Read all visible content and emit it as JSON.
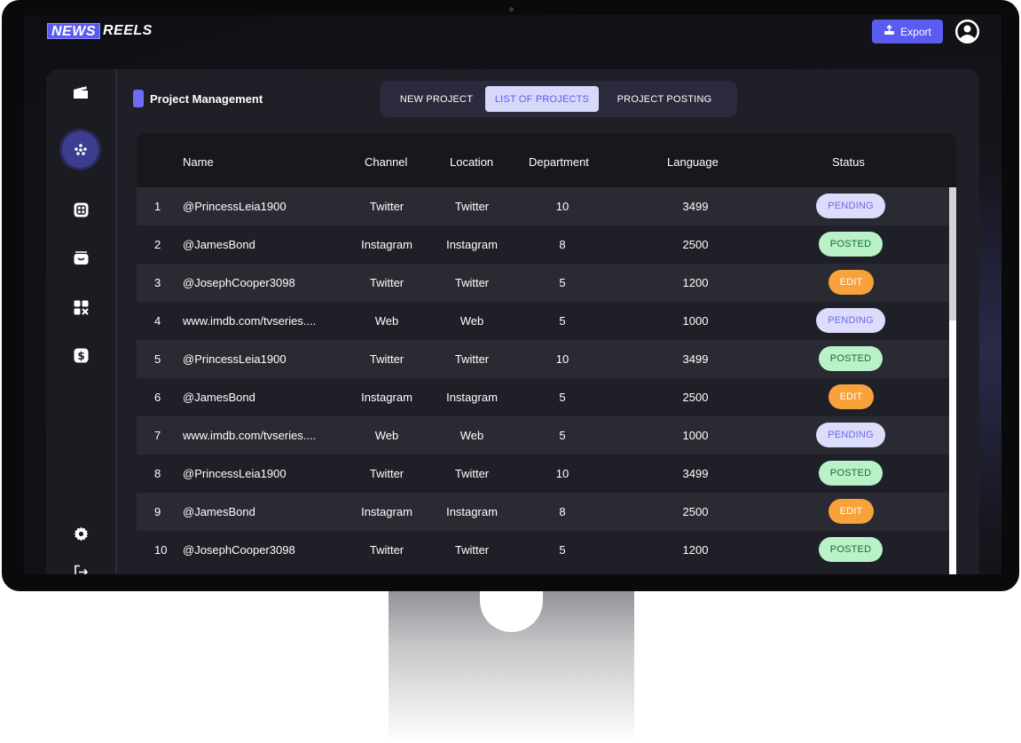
{
  "app": {
    "logo_part1": "NEWS",
    "logo_part2": "REELS",
    "export_label": "Export"
  },
  "page": {
    "title": "Project Management"
  },
  "tabs": [
    {
      "label": "NEW PROJECT",
      "active": false
    },
    {
      "label": "LIST OF PROJECTS",
      "active": true
    },
    {
      "label": "PROJECT POSTING",
      "active": false
    }
  ],
  "sidebar": {
    "items": [
      {
        "icon": "clapperboard-icon"
      },
      {
        "icon": "dots-grid-icon",
        "active": true
      },
      {
        "icon": "grid-square-icon"
      },
      {
        "icon": "inbox-icon"
      },
      {
        "icon": "puzzle-icon"
      },
      {
        "icon": "dollar-icon"
      },
      {
        "icon": "gear-icon"
      },
      {
        "icon": "logout-icon"
      }
    ]
  },
  "table": {
    "columns": [
      "Name",
      "Channel",
      "Location",
      "Department",
      "Language",
      "Status"
    ],
    "rows": [
      {
        "num": "1",
        "name": "@PrincessLeia1900",
        "channel": "Twitter",
        "location": "Twitter",
        "department": "10",
        "language": "3499",
        "status": "PENDING",
        "status_type": "pending"
      },
      {
        "num": "2",
        "name": "@JamesBond",
        "channel": "Instagram",
        "location": "Instagram",
        "department": "8",
        "language": "2500",
        "status": "POSTED",
        "status_type": "posted"
      },
      {
        "num": "3",
        "name": "@JosephCooper3098",
        "channel": "Twitter",
        "location": "Twitter",
        "department": "5",
        "language": "1200",
        "status": "EDIT",
        "status_type": "edit"
      },
      {
        "num": "4",
        "name": "www.imdb.com/tvseries....",
        "channel": "Web",
        "location": "Web",
        "department": "5",
        "language": "1000",
        "status": "PENDING",
        "status_type": "pending"
      },
      {
        "num": "5",
        "name": "@PrincessLeia1900",
        "channel": "Twitter",
        "location": "Twitter",
        "department": "10",
        "language": "3499",
        "status": "POSTED",
        "status_type": "posted"
      },
      {
        "num": "6",
        "name": "@JamesBond",
        "channel": "Instagram",
        "location": "Instagram",
        "department": "5",
        "language": "2500",
        "status": "EDIT",
        "status_type": "edit"
      },
      {
        "num": "7",
        "name": "www.imdb.com/tvseries....",
        "channel": "Web",
        "location": "Web",
        "department": "5",
        "language": "1000",
        "status": "PENDING",
        "status_type": "pending"
      },
      {
        "num": "8",
        "name": "@PrincessLeia1900",
        "channel": "Twitter",
        "location": "Twitter",
        "department": "10",
        "language": "3499",
        "status": "POSTED",
        "status_type": "posted"
      },
      {
        "num": "9",
        "name": "@JamesBond",
        "channel": "Instagram",
        "location": "Instagram",
        "department": "8",
        "language": "2500",
        "status": "EDIT",
        "status_type": "edit"
      },
      {
        "num": "10",
        "name": "@JosephCooper3098",
        "channel": "Twitter",
        "location": "Twitter",
        "department": "5",
        "language": "1200",
        "status": "POSTED",
        "status_type": "posted"
      }
    ]
  },
  "colors": {
    "accent": "#5b5bf0",
    "pending_bg": "#dcdcfb",
    "posted_bg": "#b9f2c9",
    "edit_bg": "#f7a23a"
  }
}
